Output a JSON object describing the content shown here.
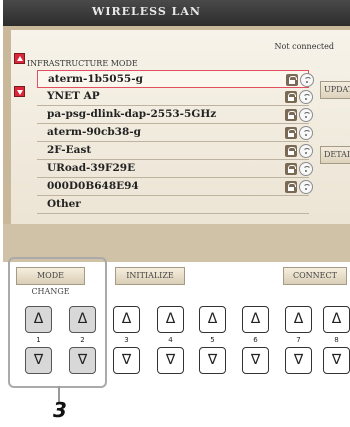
{
  "screen": {
    "title": "WIRELESS LAN",
    "status": "Not connected",
    "mode": "INFRASTRUCTURE MODE",
    "networks": [
      {
        "name": "aterm-1b5055-g",
        "selected": true
      },
      {
        "name": "YNET AP",
        "selected": false
      },
      {
        "name": "pa-psg-dlink-dap-2553-5GHz",
        "selected": false
      },
      {
        "name": "aterm-90cb38-g",
        "selected": false
      },
      {
        "name": "2F-East",
        "selected": false
      },
      {
        "name": "URoad-39F29E",
        "selected": false
      },
      {
        "name": "000D0B648E94",
        "selected": false
      },
      {
        "name": "Other",
        "selected": false
      }
    ],
    "side_buttons": {
      "update": "UPDATE",
      "detail": "DETAIL"
    },
    "soft_buttons": {
      "mode_change": "MODE CHANGE",
      "initialize": "INITIALIZE",
      "connect": "CONNECT"
    }
  },
  "hardware": {
    "up_symbol": "Δ",
    "down_symbol": "∇",
    "numbers": [
      "1",
      "2",
      "3",
      "4",
      "5",
      "6",
      "7",
      "8"
    ]
  },
  "callout": {
    "number": "3"
  },
  "icons": [
    "arrow-up-icon",
    "arrow-down-icon",
    "lock-icon",
    "wifi-icon"
  ]
}
